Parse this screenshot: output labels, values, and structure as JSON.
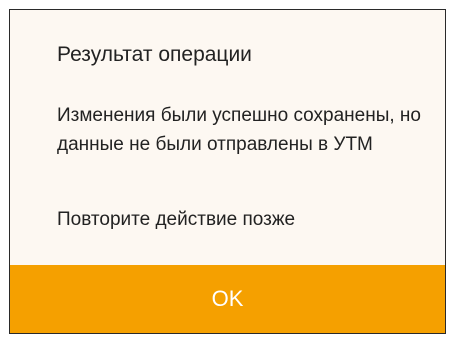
{
  "dialog": {
    "title": "Результат операции",
    "message": "Изменения были успешно сохранены, но данные не были отправлены в УТМ",
    "hint": "Повторите действие позже",
    "ok_label": "OK",
    "accent_color": "#f5a000",
    "background_color": "#fdf8f2"
  }
}
